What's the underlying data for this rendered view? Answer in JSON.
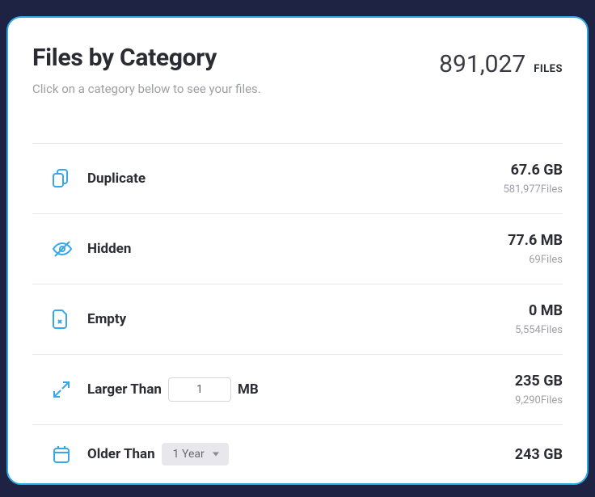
{
  "header": {
    "title": "Files by Category",
    "subtitle": "Click on a category below to see your files.",
    "total_count": "891,027",
    "total_label": "FILES"
  },
  "categories": {
    "duplicate": {
      "label": "Duplicate",
      "size": "67.6 GB",
      "file_count": "581,977",
      "file_suffix": "Files"
    },
    "hidden": {
      "label": "Hidden",
      "size": "77.6 MB",
      "file_count": "69",
      "file_suffix": "Files"
    },
    "empty": {
      "label": "Empty",
      "size": "0 MB",
      "file_count": "5,554",
      "file_suffix": "Files"
    },
    "larger_than": {
      "label_prefix": "Larger Than",
      "input_value": "1",
      "label_suffix": "MB",
      "size": "235 GB",
      "file_count": "9,290",
      "file_suffix": "Files"
    },
    "older_than": {
      "label_prefix": "Older Than",
      "dropdown_value": "1 Year",
      "size": "243 GB"
    }
  }
}
